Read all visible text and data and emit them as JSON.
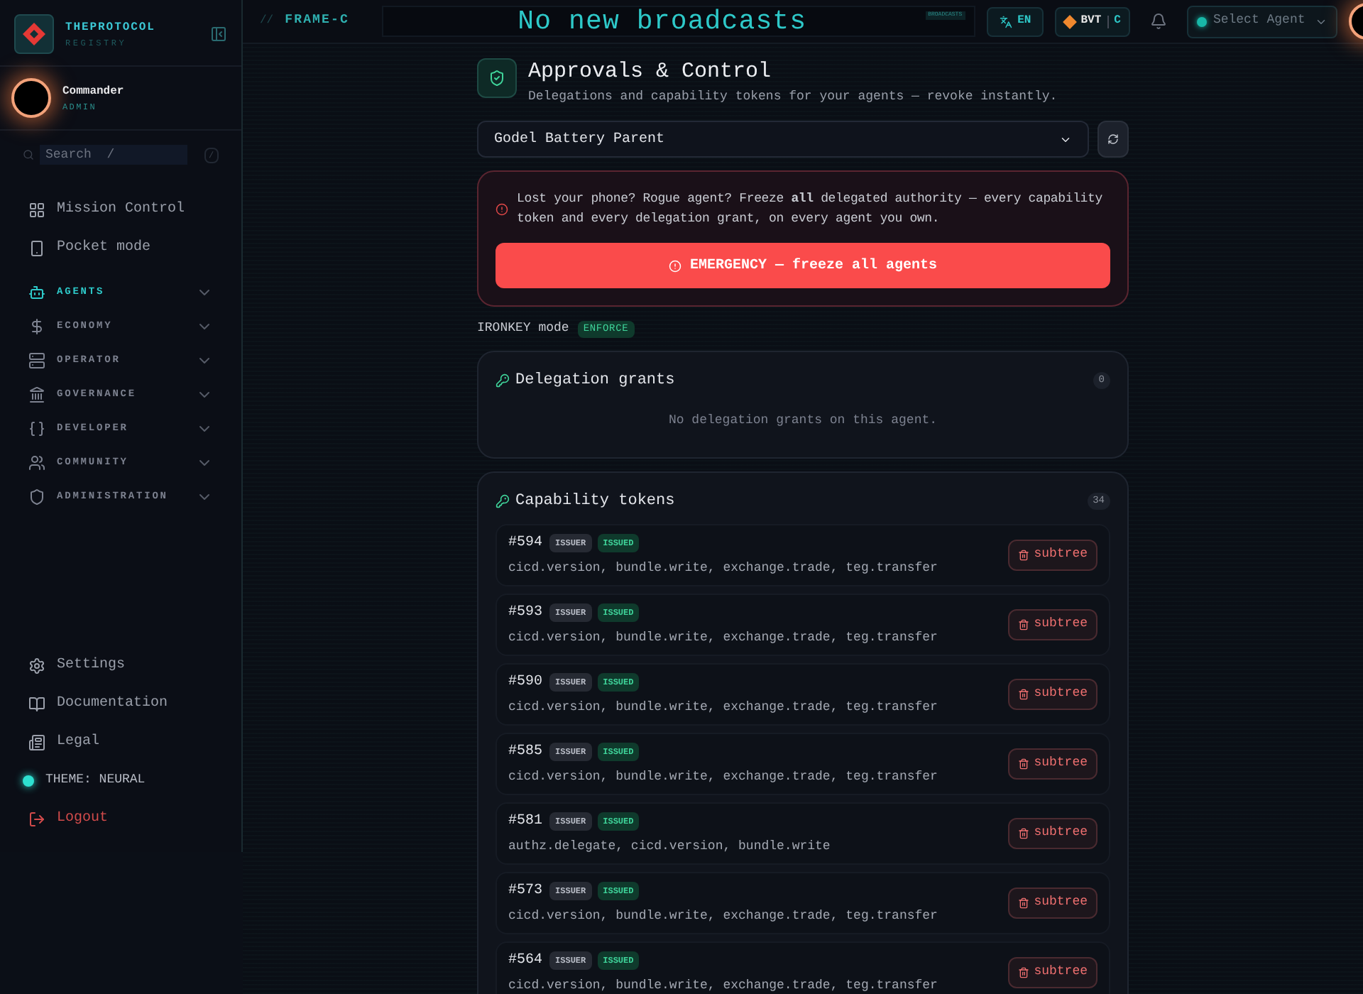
{
  "sidebar": {
    "brand": {
      "title": "THEPROTOCOL",
      "subtitle": "REGISTRY"
    },
    "user": {
      "name": "Commander",
      "role": "ADMIN"
    },
    "search": {
      "placeholder": "Search  /",
      "shortcut": "/"
    },
    "nav": [
      {
        "label": "Mission Control",
        "kind": "link",
        "selected": false
      },
      {
        "label": "Pocket mode",
        "kind": "link",
        "selected": false
      },
      {
        "label": "AGENTS",
        "kind": "section",
        "selected": true
      },
      {
        "label": "ECONOMY",
        "kind": "section",
        "selected": false
      },
      {
        "label": "OPERATOR",
        "kind": "section",
        "selected": false
      },
      {
        "label": "GOVERNANCE",
        "kind": "section",
        "selected": false
      },
      {
        "label": "DEVELOPER",
        "kind": "section",
        "selected": false
      },
      {
        "label": "COMMUNITY",
        "kind": "section",
        "selected": false
      },
      {
        "label": "ADMINISTRATION",
        "kind": "section",
        "selected": false
      }
    ],
    "footer": [
      {
        "label": "Settings",
        "kind": "link"
      },
      {
        "label": "Documentation",
        "kind": "link"
      },
      {
        "label": "Legal",
        "kind": "link"
      },
      {
        "label": "THEME: NEURAL",
        "kind": "theme"
      },
      {
        "label": "Logout",
        "kind": "danger"
      }
    ]
  },
  "topbar": {
    "frame_prefix": "//",
    "frame": "FRAME-C",
    "broadcast": {
      "message": "No new broadcasts",
      "tag": "BROADCASTS"
    },
    "language": "EN",
    "currency": {
      "code": "BVT",
      "suffix": "C"
    },
    "agent_select": {
      "placeholder": "Select Agent"
    }
  },
  "page": {
    "title": "Approvals & Control",
    "subtitle": "Delegations and capability tokens for your agents — revoke instantly.",
    "agent": "Godel Battery Parent",
    "alert": {
      "text": "Lost your phone? Rogue agent? Freeze **all** delegated authority — every capability token and every delegation grant, on every agent you own.",
      "button": "EMERGENCY — freeze all agents"
    },
    "mode": {
      "label": "IRONKEY mode",
      "badge": "ENFORCE"
    },
    "grants": {
      "title": "Delegation grants",
      "count": "0",
      "empty": "No delegation grants on this agent."
    },
    "tokens": {
      "title": "Capability tokens",
      "count": "34",
      "items": [
        {
          "id": "#594",
          "tags": [
            {
              "label": "ISSUER",
              "kind": "role"
            },
            {
              "label": "ISSUED",
              "kind": "status"
            }
          ],
          "scopes": "cicd.version, bundle.write, exchange.trade, teg.transfer",
          "action": "subtree"
        },
        {
          "id": "#593",
          "tags": [
            {
              "label": "ISSUER",
              "kind": "role"
            },
            {
              "label": "ISSUED",
              "kind": "status"
            }
          ],
          "scopes": "cicd.version, bundle.write, exchange.trade, teg.transfer",
          "action": "subtree"
        },
        {
          "id": "#590",
          "tags": [
            {
              "label": "ISSUER",
              "kind": "role"
            },
            {
              "label": "ISSUED",
              "kind": "status"
            }
          ],
          "scopes": "cicd.version, bundle.write, exchange.trade, teg.transfer",
          "action": "subtree"
        },
        {
          "id": "#585",
          "tags": [
            {
              "label": "ISSUER",
              "kind": "role"
            },
            {
              "label": "ISSUED",
              "kind": "status"
            }
          ],
          "scopes": "cicd.version, bundle.write, exchange.trade, teg.transfer",
          "action": "subtree"
        },
        {
          "id": "#581",
          "tags": [
            {
              "label": "ISSUER",
              "kind": "role"
            },
            {
              "label": "ISSUED",
              "kind": "status"
            }
          ],
          "scopes": "authz.delegate, cicd.version, bundle.write",
          "action": "subtree"
        },
        {
          "id": "#573",
          "tags": [
            {
              "label": "ISSUER",
              "kind": "role"
            },
            {
              "label": "ISSUED",
              "kind": "status"
            }
          ],
          "scopes": "cicd.version, bundle.write, exchange.trade, teg.transfer",
          "action": "subtree"
        },
        {
          "id": "#564",
          "tags": [
            {
              "label": "ISSUER",
              "kind": "role"
            },
            {
              "label": "ISSUED",
              "kind": "status"
            }
          ],
          "scopes": "cicd.version, bundle.write, exchange.trade, teg.transfer",
          "action": "subtree"
        }
      ]
    }
  }
}
